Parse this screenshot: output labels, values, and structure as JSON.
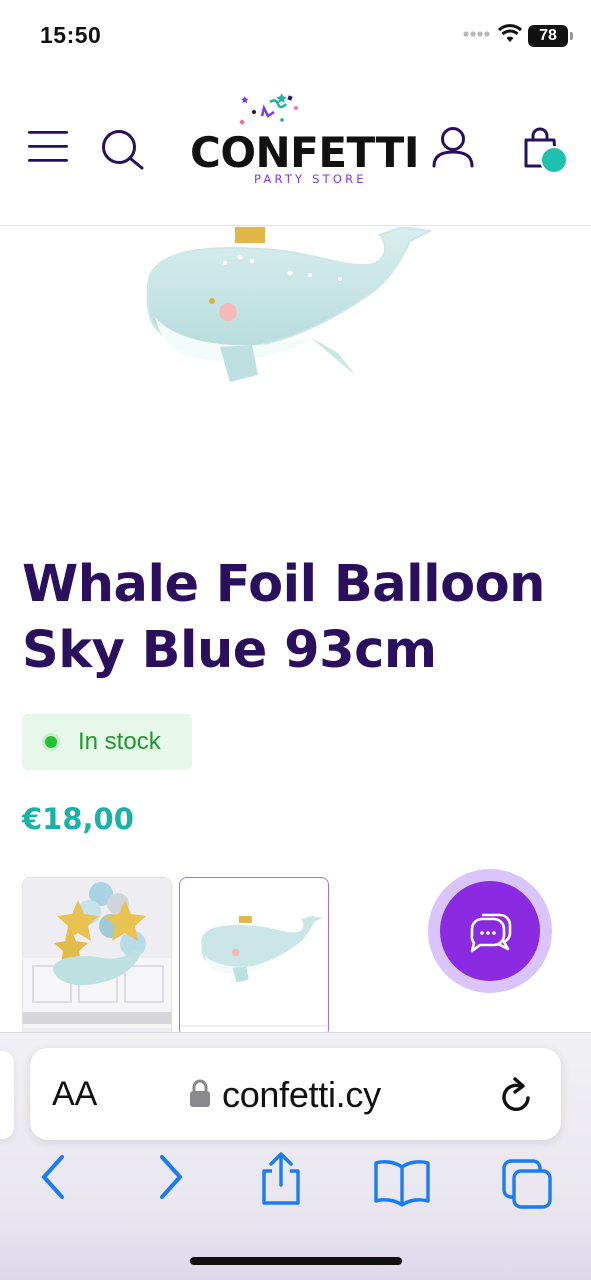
{
  "status_bar": {
    "time": "15:50",
    "battery": "78",
    "icons": [
      "signal-dots-icon",
      "wifi-icon",
      "battery-icon"
    ]
  },
  "header": {
    "logo_text": "CONFETTI",
    "logo_subtitle": "PARTY STORE",
    "icons": [
      "menu-icon",
      "search-icon",
      "account-icon",
      "cart-icon"
    ]
  },
  "product": {
    "title": "Whale Foil Balloon Sky Blue 93cm",
    "stock_status": "In stock",
    "price": "€18,00"
  },
  "thumbnails": [
    {
      "name": "bouquet-thumbnail",
      "selected": false
    },
    {
      "name": "whale-thumbnail",
      "selected": true
    }
  ],
  "browser": {
    "text_size_label": "AA",
    "url": "confetti.cy",
    "toolbar_icons": [
      "back-icon",
      "forward-icon",
      "share-icon",
      "bookmarks-icon",
      "tabs-icon"
    ]
  },
  "colors": {
    "brand_purple": "#2a0f5c",
    "accent_purple": "#8a2be2",
    "teal": "#17b3a6",
    "stock_green": "#1e9a2b",
    "browser_blue": "#1a7cf5"
  }
}
